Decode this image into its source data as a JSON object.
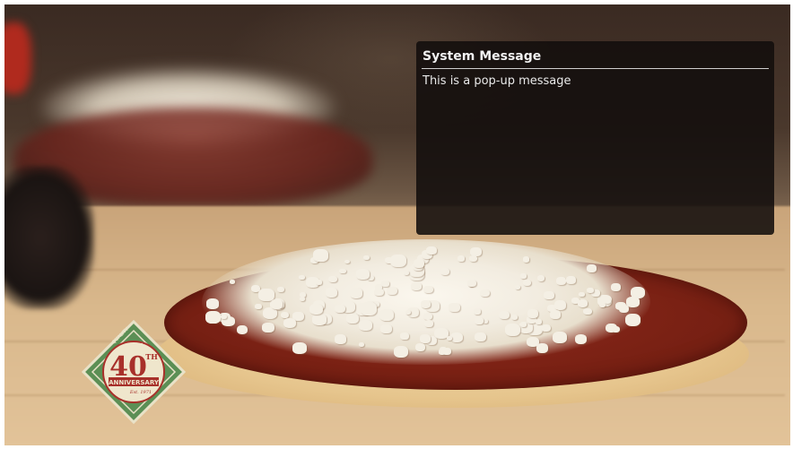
{
  "popup": {
    "title": "System Message",
    "message": "This is a pop-up message"
  },
  "logo": {
    "number": "40",
    "superscript": "TH",
    "banner": "ANNIVERSARY",
    "year_text": "Est. 1971",
    "ring_words": [
      "QUALITY",
      "AUTHENTIC",
      "INTEGRITY",
      "FAMILY"
    ]
  },
  "colors": {
    "popup_bg": "#120e0c",
    "popup_text": "#f2f2f2",
    "badge_green": "#5c8f55",
    "badge_red": "#a8302a"
  }
}
